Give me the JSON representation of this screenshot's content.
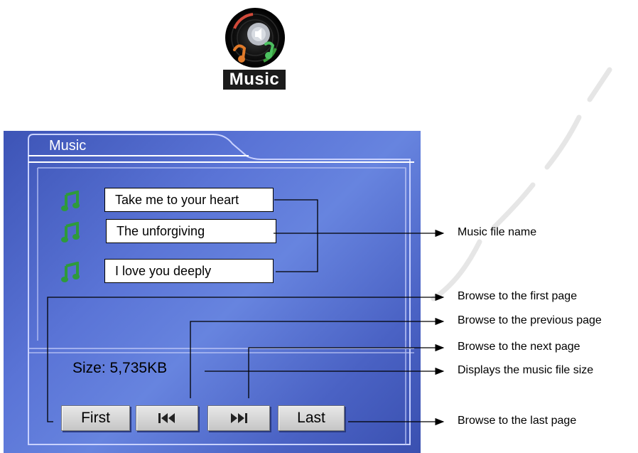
{
  "app_icon": {
    "caption": "Music",
    "icon": "music-disc-icon"
  },
  "panel": {
    "title": "Music",
    "songs": [
      {
        "name": "Take me to your heart",
        "icon": "music-note-icon"
      },
      {
        "name": "The unforgiving",
        "icon": "music-note-icon"
      },
      {
        "name": "I love you deeply",
        "icon": "music-note-icon"
      }
    ],
    "size_text": "Size: 5,735KB",
    "buttons": {
      "first": "First",
      "previous_icon": "skip-previous-icon",
      "next_icon": "skip-next-icon",
      "last": "Last"
    }
  },
  "annotations": {
    "file_name": "Music file name",
    "first_page": "Browse to the first page",
    "previous_page": "Browse to the previous page",
    "next_page": "Browse to the next page",
    "file_size": "Displays the music file size",
    "last_page": "Browse to the last page"
  },
  "colors": {
    "panel_blue": "#4f67c9",
    "note_green": "#2e9a3c",
    "button_gray": "#d4d4d4"
  }
}
